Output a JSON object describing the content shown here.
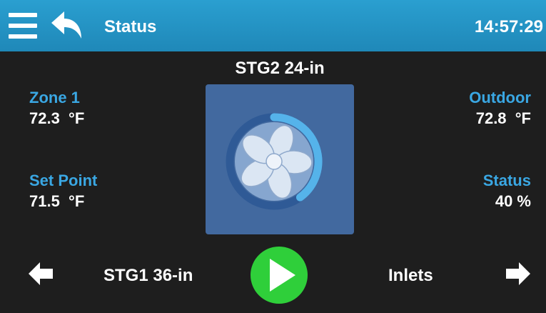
{
  "header": {
    "title": "Status",
    "time": "14:57:29",
    "menu_icon": "hamburger-menu-icon",
    "back_icon": "back-arrow-icon",
    "background": "#2a9fd0"
  },
  "device": {
    "name": "STG2 24-in",
    "fan_icon": "fan-icon",
    "fan_level_percent": 40
  },
  "zone": {
    "label": "Zone 1",
    "value": "72.3  °F"
  },
  "set_point": {
    "label": "Set Point",
    "value": "71.5  °F"
  },
  "outdoor": {
    "label": "Outdoor",
    "value": "72.8  °F"
  },
  "status": {
    "label": "Status",
    "value": "40 %"
  },
  "navigation": {
    "previous_label": "STG1 36-in",
    "next_label": "Inlets",
    "left_icon": "arrow-left-icon",
    "right_icon": "arrow-right-icon",
    "play_icon": "play-icon"
  },
  "colors": {
    "accent": "#3aa7e3",
    "tile": "#42699f",
    "play": "#2fcf3a",
    "background": "#1e1e1e"
  }
}
